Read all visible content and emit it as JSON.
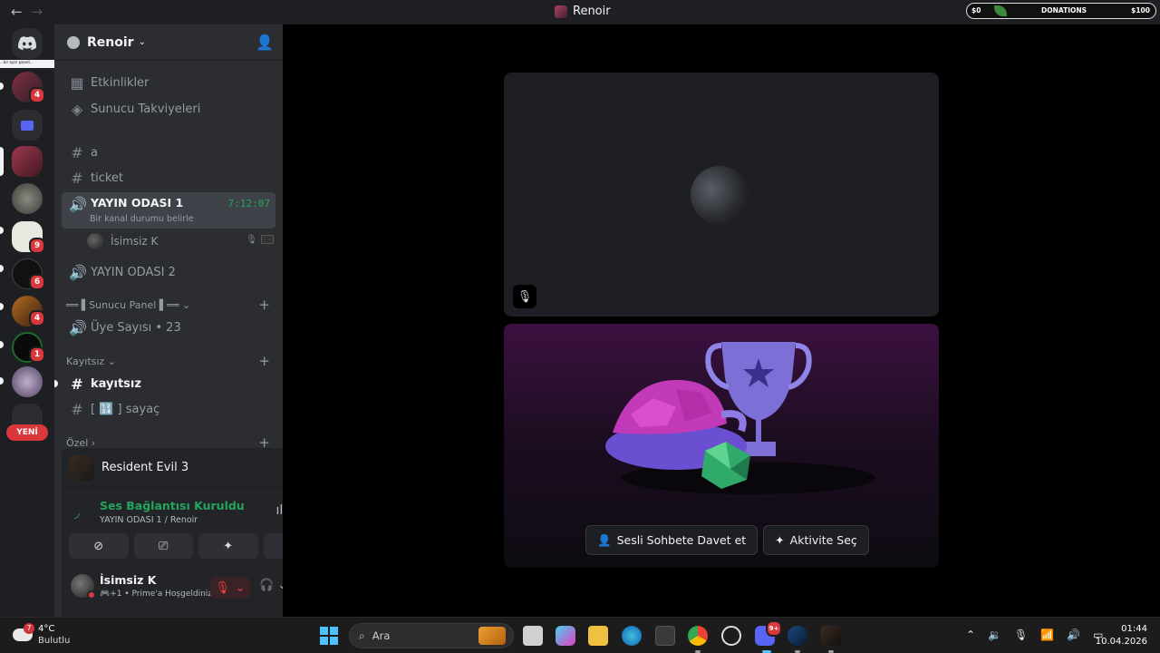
{
  "titlebar": {
    "title": "Renoir",
    "back": "←",
    "forward": "→",
    "overlay": {
      "left_value": "$0",
      "center_label": "DONATIONS",
      "right_value": "$100"
    }
  },
  "rail": {
    "yeni_label": "YENİ",
    "badges": [
      "4",
      "9",
      "6",
      "4",
      "1"
    ],
    "tooltip_text": "...bir ayar paneli...",
    "colors": {
      "badge": "#da373c",
      "online": "#23a55a"
    }
  },
  "server": {
    "name": "Renoir",
    "header_items": [
      {
        "icon": "calendar-icon",
        "label": "Etkinlikler"
      },
      {
        "icon": "boost-icon",
        "label": "Sunucu Takviyeleri"
      }
    ],
    "channels": {
      "a": "a",
      "ticket": "ticket",
      "yayin1": "YAYIN ODASI 1",
      "yayin1_timer": "7:12:07",
      "yayin1_status": "Bir kanal durumu belirle",
      "voice_user": "İsimsiz K",
      "yayin2": "YAYIN ODASI 2",
      "panel_category": "══ ▌Sunucu Panel ▌══",
      "uye_sayisi": "Üye Sayısı • 23",
      "kayitsiz_category": "Kayıtsız",
      "kayitsiz": "kayıtsız",
      "sayac": "[ 🔢 ] sayaç",
      "ozel_category": "Özel"
    }
  },
  "panel": {
    "game": "Resident Evil 3",
    "voice_title": "Ses Bağlantısı Kuruldu",
    "voice_sub": "YAYIN ODASI 1 / Renoir",
    "username": "İsimsiz K",
    "user_status": "+1 • Prime'a Hoşgeldiniz"
  },
  "stage": {
    "invite_button": "Sesli Sohbete Davet et",
    "activity_button": "Aktivite Seç"
  },
  "taskbar": {
    "temp": "4°C",
    "condition": "Bulutlu",
    "weather_badge": "7",
    "search_placeholder": "Ara",
    "discord_badge": "9+",
    "time": "01:44",
    "date": "10.04.2026"
  }
}
